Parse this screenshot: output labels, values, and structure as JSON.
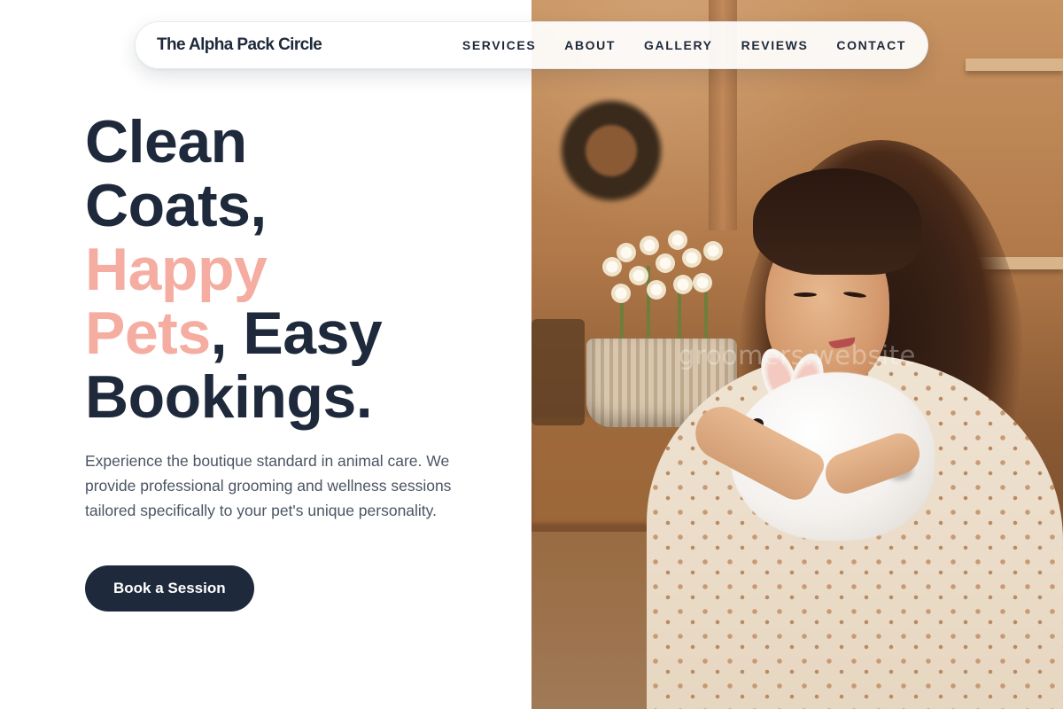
{
  "nav": {
    "brand": "The Alpha Pack Circle",
    "links": [
      "SERVICES",
      "ABOUT",
      "GALLERY",
      "REVIEWS",
      "CONTACT"
    ]
  },
  "hero": {
    "title_line1": "Clean",
    "title_line2": "Coats,",
    "title_accent_1": "Happy",
    "title_accent_2": "Pets",
    "title_line4_rest": ", Easy",
    "title_line5": "Bookings.",
    "description": "Experience the boutique standard in animal care. We provide professional grooming and wellness sessions tailored specifically to your pet's unique personality.",
    "cta_label": "Book a Session"
  },
  "image": {
    "watermark": "groomers.website"
  },
  "colors": {
    "navy": "#1e293b",
    "accent_peach": "#f5ada1",
    "body_text": "#4b5563"
  }
}
